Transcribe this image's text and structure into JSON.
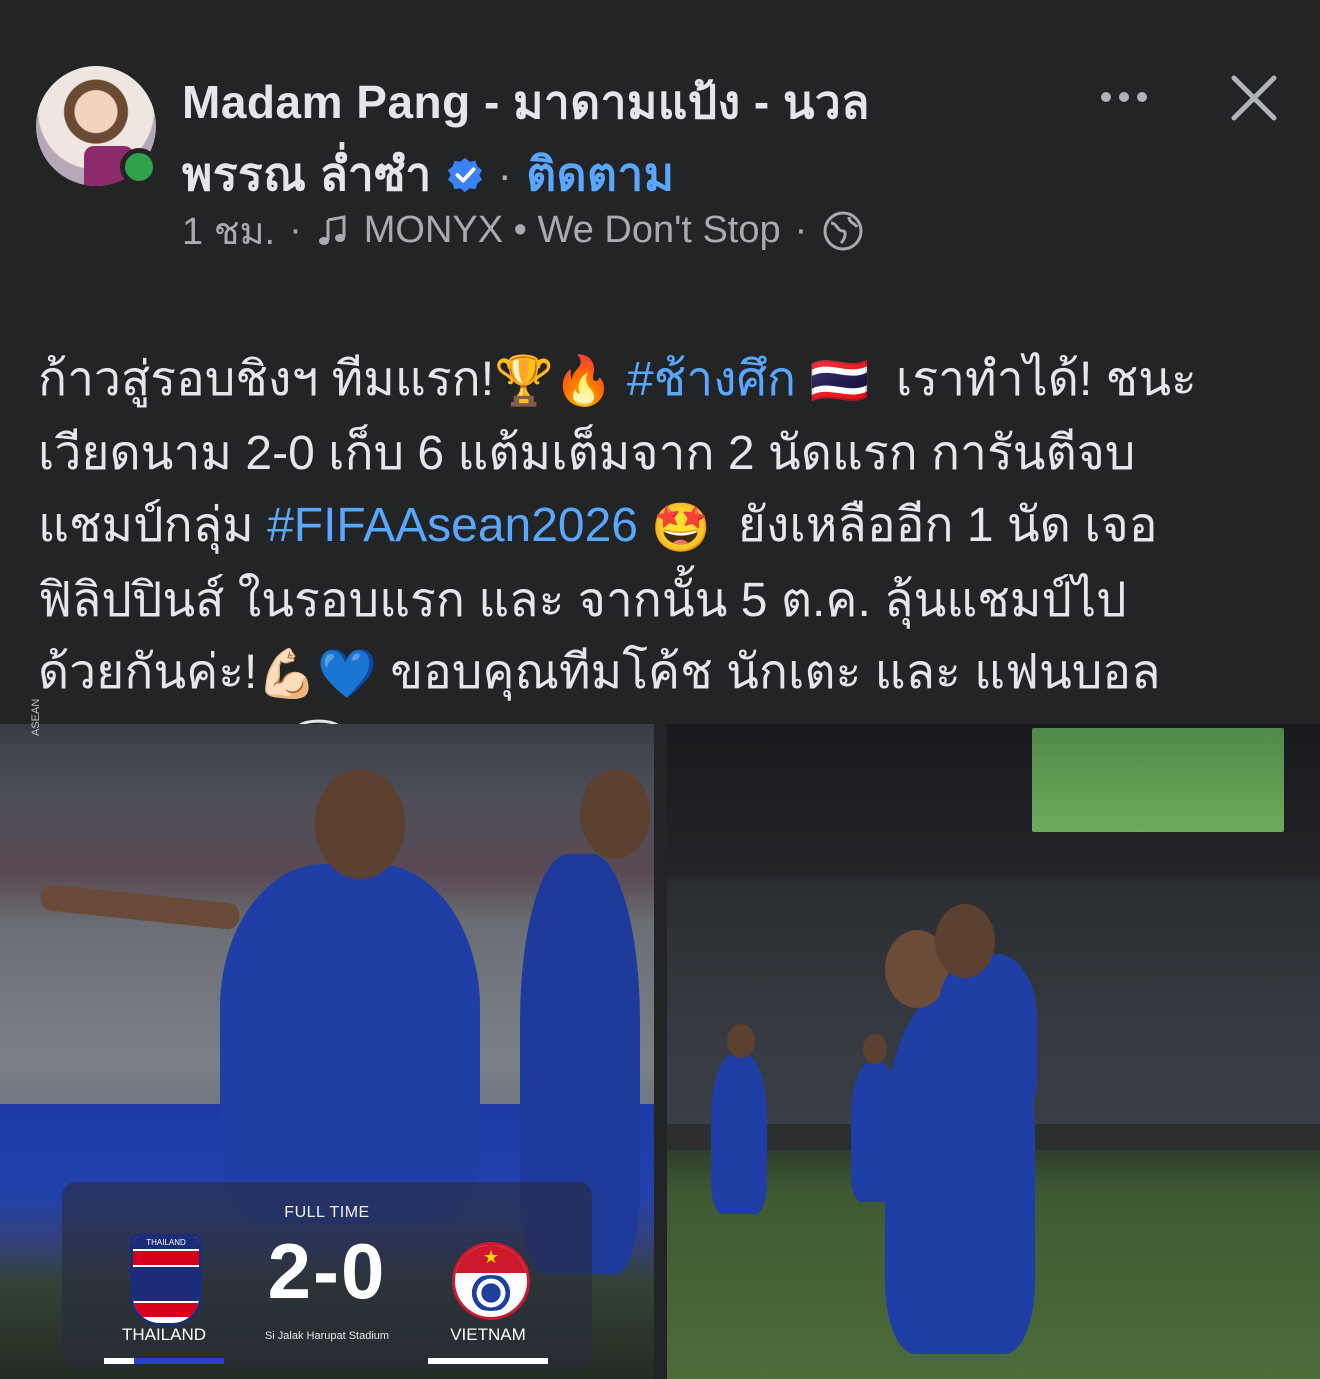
{
  "post": {
    "author_name_line1": "Madam Pang - มาดามแป้ง - นวล",
    "author_name_line2": "พรรณ ล่ำซำ",
    "separator": "·",
    "follow_label": "ติดตาม",
    "time": "1 ชม.",
    "music": "MONYX • We Don't Stop",
    "text_segments": [
      {
        "text": "ก้าวสู่รอบชิงฯ ทีมแรก!",
        "type": "text"
      },
      {
        "text": "🏆🔥",
        "type": "emoji"
      },
      {
        "text": " ",
        "type": "text"
      },
      {
        "text": "#ช้างศึก",
        "type": "hashtag"
      },
      {
        "text": " 🇹🇭 ",
        "type": "emoji"
      },
      {
        "text": " เราทำได้! ชนะ\nเวียดนาม 2-0 เก็บ 6 แต้มเต็มจาก 2 นัดแรก การันตีจบ\nแชมป์กลุ่ม ",
        "type": "text"
      },
      {
        "text": "#FIFAAsean2026",
        "type": "hashtag"
      },
      {
        "text": " 🤩 ",
        "type": "emoji"
      },
      {
        "text": " ยังเหลืออีก 1 นัด เจอ\nฟิลิปปินส์ ในรอบแรก และ จากนั้น 5 ต.ค. ลุ้นแชมป์ไป\nด้วยกันค่ะ!",
        "type": "text"
      },
      {
        "text": "💪🏻💙",
        "type": "emoji"
      },
      {
        "text": " ขอบคุณทีมโค้ช นักเตะ และ แฟนบอล\nทุกคนนะคะ ",
        "type": "text"
      },
      {
        "text": "😇",
        "type": "emoji"
      }
    ]
  },
  "scoreboard": {
    "label": "FULL TIME",
    "score": "2-0",
    "team_home": "THAILAND",
    "team_away": "VIETNAM",
    "stadium": "Si Jalak Harupat Stadium",
    "home_badge_caption": "THAILAND"
  },
  "photo_caption_left": "ASEAN",
  "colors": {
    "background": "#232425",
    "link": "#5aa7ff",
    "online": "#31a24c"
  },
  "icons": [
    "more-icon",
    "close-icon",
    "verified-icon",
    "music-icon",
    "globe-icon"
  ]
}
